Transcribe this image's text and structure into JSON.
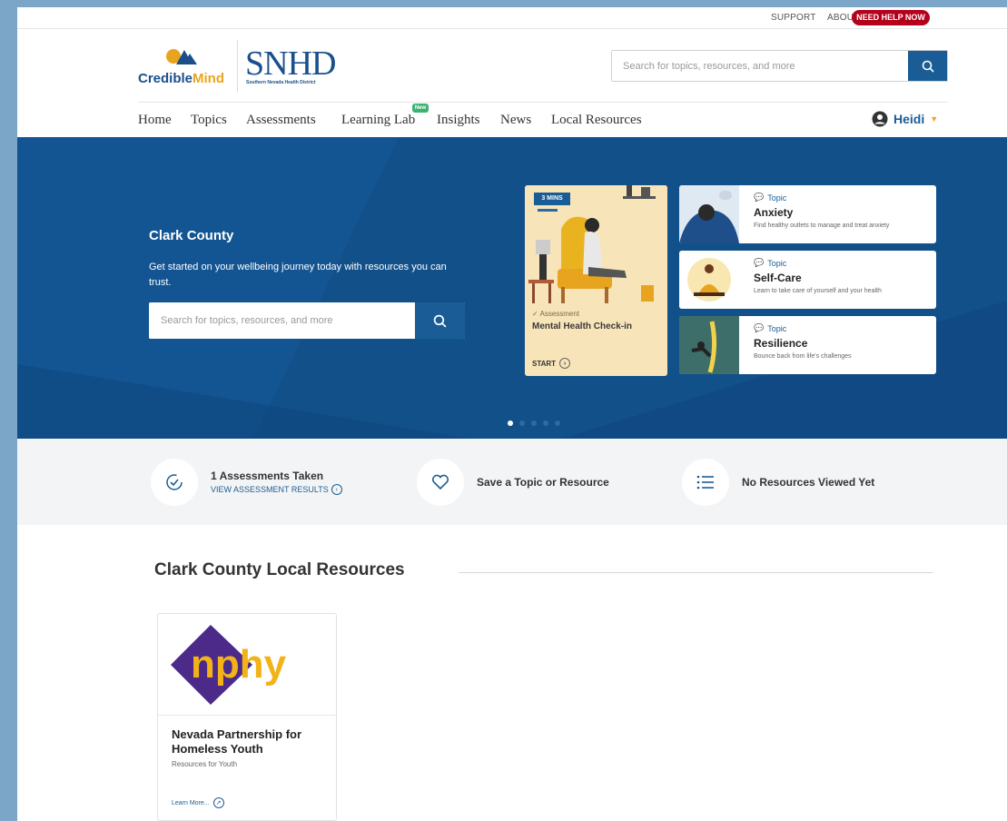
{
  "utility": {
    "support": "SUPPORT",
    "about": "ABOUT",
    "help": "NEED HELP NOW"
  },
  "logo": {
    "brand_a": "Credible",
    "brand_b": "Mind",
    "partner": "SNHD",
    "partner_sub": "Southern Nevada Health District"
  },
  "search": {
    "placeholder": "Search for topics, resources, and more"
  },
  "nav": {
    "items": [
      "Home",
      "Topics",
      "Assessments",
      "Learning Lab",
      "Insights",
      "News",
      "Local Resources"
    ],
    "new_badge": "New"
  },
  "user": {
    "name": "Heidi"
  },
  "hero": {
    "title": "Clark County",
    "subtitle": "Get started on your wellbeing journey today with resources you can trust.",
    "search_placeholder": "Search for topics, resources, and more",
    "assessment": {
      "duration": "3 MINS",
      "kind": "Assessment",
      "title": "Mental Health Check-in",
      "cta": "START"
    },
    "topics": [
      {
        "kind": "Topic",
        "name": "Anxiety",
        "desc": "Find healthy outlets to manage and treat anxiety"
      },
      {
        "kind": "Topic",
        "name": "Self-Care",
        "desc": "Learn to take care of yourself and your health"
      },
      {
        "kind": "Topic",
        "name": "Resilience",
        "desc": "Bounce back from life's challenges"
      }
    ],
    "slides": {
      "active_index": 0
    }
  },
  "stats": [
    {
      "title": "1 Assessments Taken",
      "link": "VIEW ASSESSMENT RESULTS",
      "icon": "check-circle-icon"
    },
    {
      "title": "Save a Topic or Resource",
      "icon": "heart-icon"
    },
    {
      "title": "No Resources Viewed Yet",
      "icon": "list-icon"
    }
  ],
  "local": {
    "title": "Clark County Local Resources",
    "card": {
      "logo_text": "nphy",
      "name": "Nevada Partnership for Homeless Youth",
      "desc": "Resources for Youth",
      "link": "Learn More..."
    }
  },
  "colors": {
    "primary": "#1a5d96",
    "hero_bg": "#12508a",
    "help_red": "#b3001b",
    "accent_yellow": "#e9a41f",
    "nphy_purple": "#4b2a8a",
    "nphy_yellow": "#f2b318"
  }
}
